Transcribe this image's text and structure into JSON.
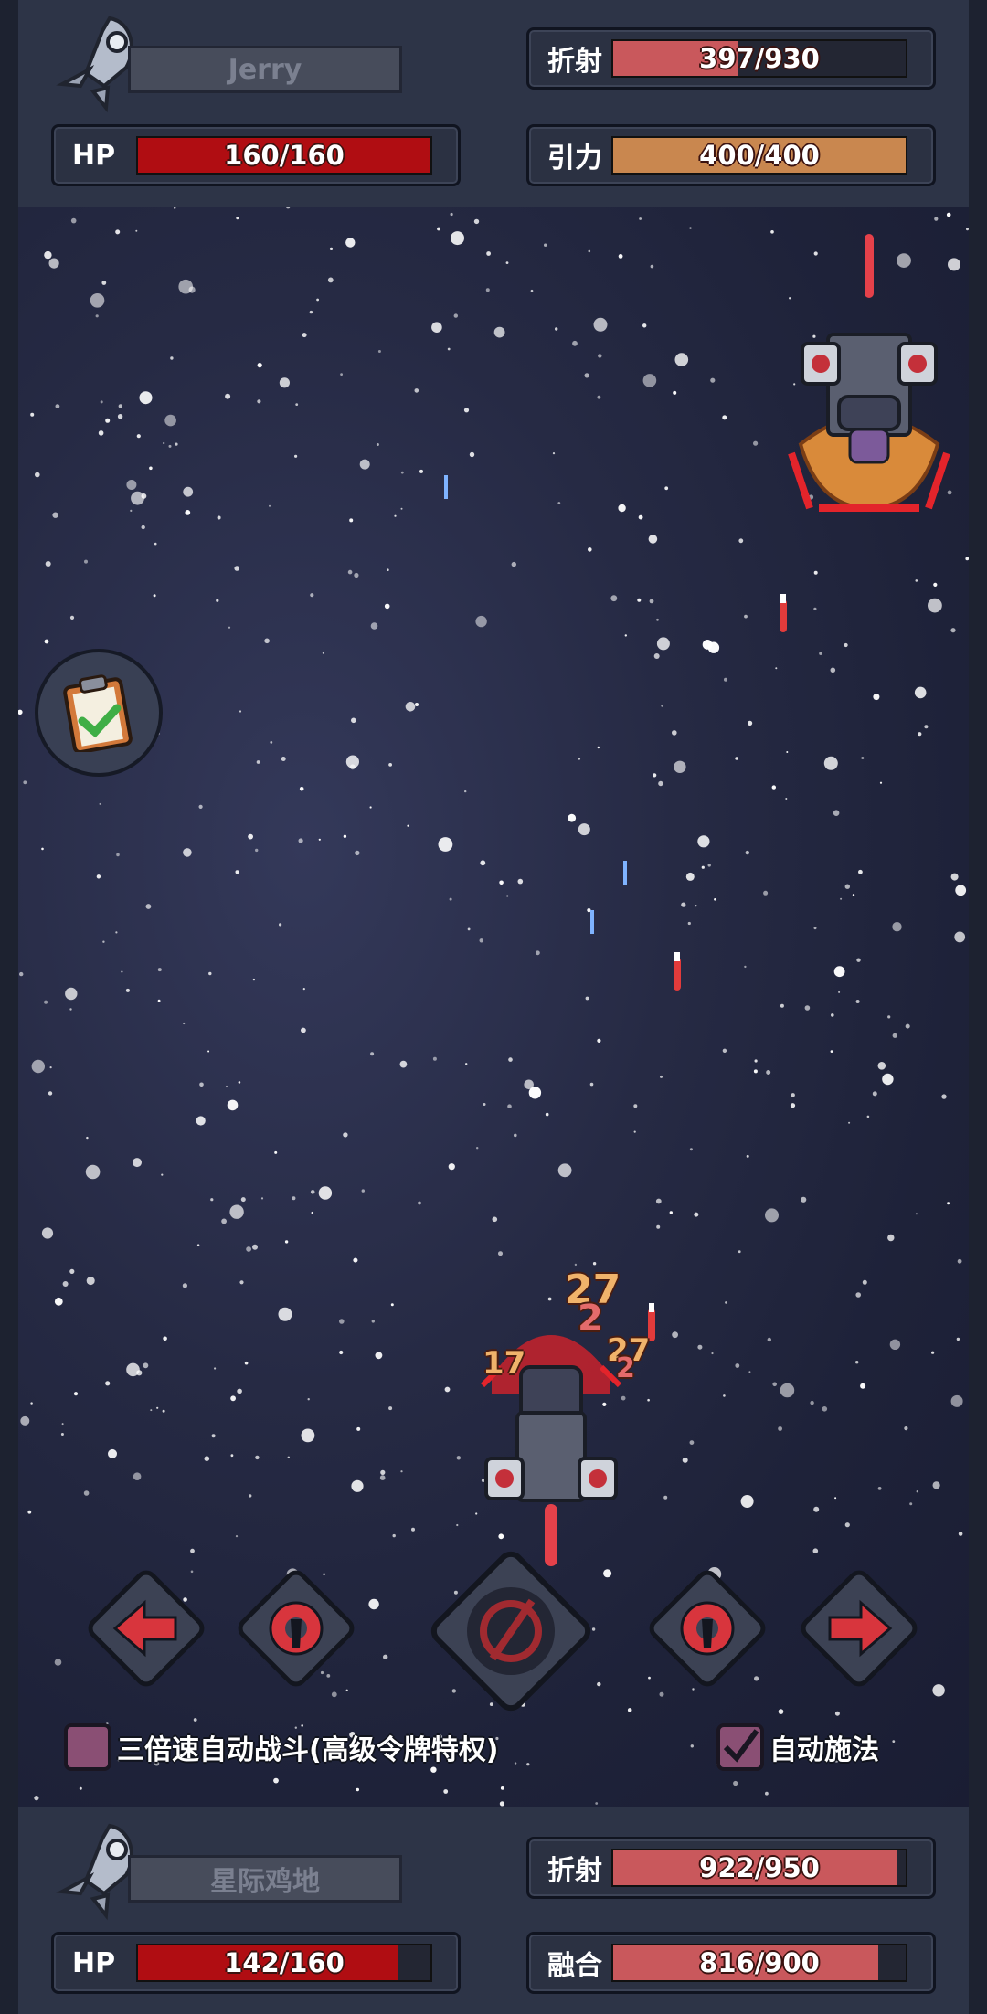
{
  "opponent": {
    "name": "Jerry",
    "hp": {
      "label": "HP",
      "text": "160/160",
      "current": 160,
      "max": 160,
      "color": "#b00d12"
    },
    "stat1": {
      "label": "折射",
      "text": "397/930",
      "current": 397,
      "max": 930,
      "color": "#c9585c"
    },
    "stat2": {
      "label": "引力",
      "text": "400/400",
      "current": 400,
      "max": 400,
      "color": "#c9874f"
    }
  },
  "player": {
    "name": "星际鸡地",
    "hp": {
      "label": "HP",
      "text": "142/160",
      "current": 142,
      "max": 160,
      "color": "#b00d12"
    },
    "stat1": {
      "label": "折射",
      "text": "922/950",
      "current": 922,
      "max": 950,
      "color": "#c9585c"
    },
    "stat2": {
      "label": "融合",
      "text": "816/900",
      "current": 816,
      "max": 900,
      "color": "#c9585c"
    }
  },
  "damage_numbers": [
    "27",
    "2",
    "27",
    "2",
    "17"
  ],
  "controls": {
    "left": "left-arrow-icon",
    "skill1": "wrench-gear-icon",
    "main": "prohibited-icon",
    "skill2": "wrench-gear-icon",
    "right": "right-arrow-icon"
  },
  "options": {
    "triple_speed": {
      "label": "三倍速自动战斗(高级令牌特权)",
      "checked": false
    },
    "auto_cast": {
      "label": "自动施法",
      "checked": true
    }
  },
  "colors": {
    "accent_checkbox": "#8a4f74",
    "control_red": "#d8353d"
  }
}
